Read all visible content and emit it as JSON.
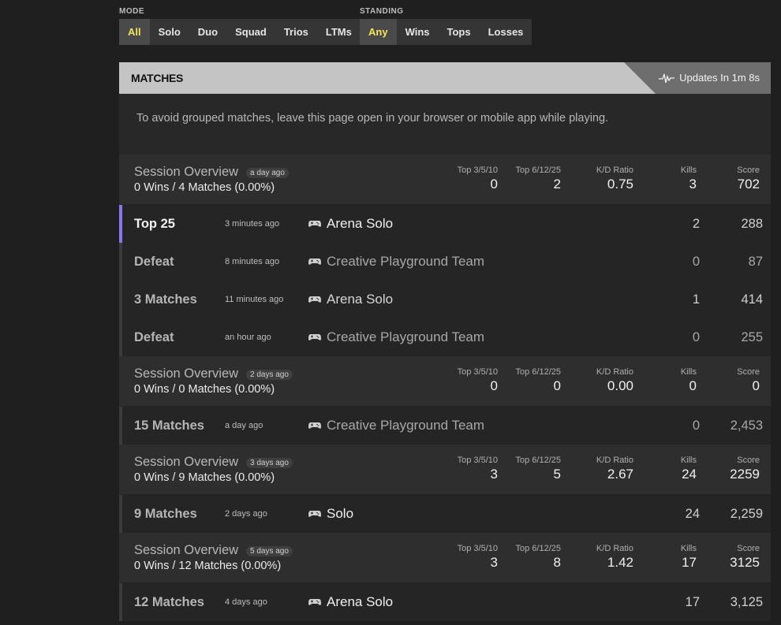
{
  "filters": {
    "mode": {
      "label": "MODE",
      "options": [
        "All",
        "Solo",
        "Duo",
        "Squad",
        "Trios",
        "LTMs"
      ],
      "selected": "All"
    },
    "standing": {
      "label": "STANDING",
      "options": [
        "Any",
        "Wins",
        "Tops",
        "Losses"
      ],
      "selected": "Any"
    }
  },
  "matches_header": {
    "title": "MATCHES",
    "update_text": "Updates In 1m 8s",
    "update_icon": "activity-pulse-icon"
  },
  "notice": "To avoid grouped matches, leave this page open in your browser or mobile app while playing.",
  "stat_labels": {
    "top_3_5_10": "Top 3/5/10",
    "top_6_12_25": "Top 6/12/25",
    "kd_ratio": "K/D Ratio",
    "kills": "Kills",
    "score": "Score"
  },
  "rows": [
    {
      "type": "session",
      "title": "Session Overview",
      "ago": "a day ago",
      "summary": "0 Wins / 4 Matches (0.00%)",
      "top_3_5_10": "0",
      "top_6_12_25": "2",
      "kd_ratio": "0.75",
      "kills": "3",
      "score": "702"
    },
    {
      "type": "match",
      "result": "Top 25",
      "time": "3 minutes ago",
      "mode": "Arena Solo",
      "kills": "2",
      "score": "288",
      "accent": true
    },
    {
      "type": "match",
      "result": "Defeat",
      "time": "8 minutes ago",
      "mode": "Creative Playground Team",
      "kills": "0",
      "score": "87",
      "dim": true
    },
    {
      "type": "match",
      "result": "3 Matches",
      "time": "11 minutes ago",
      "mode": "Arena Solo",
      "kills": "1",
      "score": "414"
    },
    {
      "type": "match",
      "result": "Defeat",
      "time": "an hour ago",
      "mode": "Creative Playground Team",
      "kills": "0",
      "score": "255",
      "dim": true
    },
    {
      "type": "session",
      "title": "Session Overview",
      "ago": "2 days ago",
      "summary": "0 Wins / 0 Matches (0.00%)",
      "top_3_5_10": "0",
      "top_6_12_25": "0",
      "kd_ratio": "0.00",
      "kills": "0",
      "score": "0"
    },
    {
      "type": "match",
      "result": "15 Matches",
      "time": "a day ago",
      "mode": "Creative Playground Team",
      "kills": "0",
      "score": "2,453",
      "dim": true
    },
    {
      "type": "session",
      "title": "Session Overview",
      "ago": "3 days ago",
      "summary": "0 Wins / 9 Matches (0.00%)",
      "top_3_5_10": "3",
      "top_6_12_25": "5",
      "kd_ratio": "2.67",
      "kills": "24",
      "score": "2259"
    },
    {
      "type": "match",
      "result": "9 Matches",
      "time": "2 days ago",
      "mode": "Solo",
      "kills": "24",
      "score": "2,259",
      "bright": true
    },
    {
      "type": "session",
      "title": "Session Overview",
      "ago": "5 days ago",
      "summary": "0 Wins / 12 Matches (0.00%)",
      "top_3_5_10": "3",
      "top_6_12_25": "8",
      "kd_ratio": "1.42",
      "kills": "17",
      "score": "3125"
    },
    {
      "type": "match",
      "result": "12 Matches",
      "time": "4 days ago",
      "mode": "Arena Solo",
      "kills": "17",
      "score": "3,125",
      "bright": true
    }
  ],
  "colors": {
    "accent_yellow": "#f7e35a",
    "accent_purple": "#8a75f0",
    "background": "#1f1f1f"
  }
}
